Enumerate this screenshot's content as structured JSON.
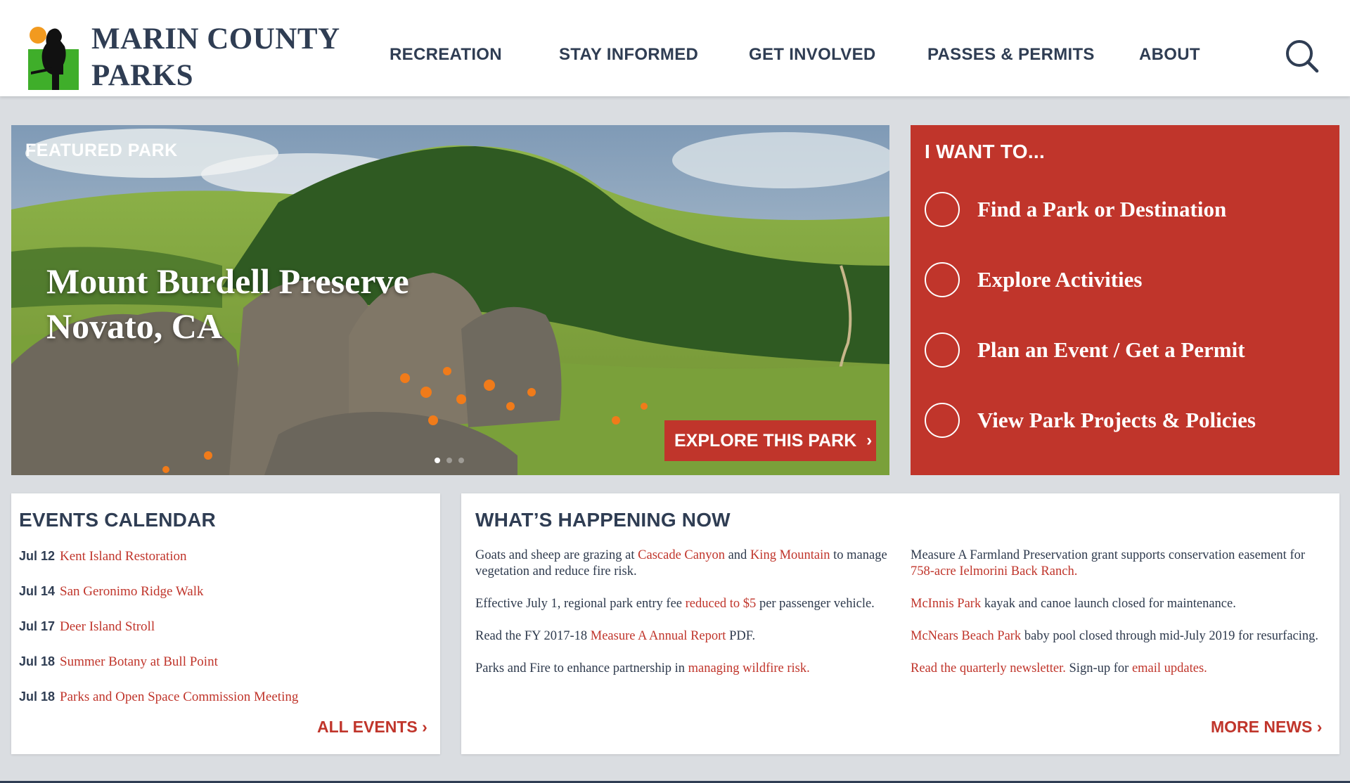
{
  "brand": {
    "line1": "MARIN COUNTY",
    "line2": "PARKS"
  },
  "nav": {
    "items": [
      "RECREATION",
      "STAY INFORMED",
      "GET INVOLVED",
      "PASSES & PERMITS",
      "ABOUT"
    ]
  },
  "featured": {
    "label": "FEATURED PARK",
    "title_line1": "Mount Burdell Preserve",
    "title_line2": "Novato, CA",
    "cta": "EXPLORE THIS PARK",
    "slide_count": 3,
    "active_slide": 1
  },
  "iwant": {
    "title": "I WANT TO...",
    "items": [
      "Find a Park or Destination",
      "Explore Activities",
      "Plan an Event / Get a Permit",
      "View Park Projects & Policies"
    ]
  },
  "events": {
    "title": "EVENTS CALENDAR",
    "items": [
      {
        "date": "Jul 12",
        "name": "Kent Island Restoration"
      },
      {
        "date": "Jul 14",
        "name": "San Geronimo Ridge Walk"
      },
      {
        "date": "Jul 17",
        "name": "Deer Island Stroll"
      },
      {
        "date": "Jul 18",
        "name": "Summer Botany at Bull Point"
      },
      {
        "date": "Jul 18",
        "name": "Parks and Open Space Commission Meeting"
      }
    ],
    "more": "ALL EVENTS"
  },
  "news": {
    "title": "WHAT’S HAPPENING NOW",
    "col1": [
      {
        "t1": "Goats and sheep are grazing at ",
        "l1": "Cascade Canyon",
        "t2": " and ",
        "l2": "King Mountain",
        "t3": " to manage vegetation and reduce fire risk."
      },
      {
        "t1": "Effective July 1, regional park entry fee ",
        "l1": "reduced to $5",
        "t2": " per passenger vehicle."
      },
      {
        "t1": "Read the FY 2017-18 ",
        "l1": "Measure A Annual Report",
        "t2": " PDF."
      },
      {
        "t1": "Parks and Fire to enhance partnership in ",
        "l1": "managing wildfire risk."
      }
    ],
    "col2": [
      {
        "t1": "Measure A Farmland Preservation grant supports conservation easement for ",
        "l1": "758-acre Ielmorini Back Ranch."
      },
      {
        "l1": "McInnis Park",
        "t2": " kayak and canoe launch closed for maintenance."
      },
      {
        "l1": "McNears Beach Park",
        "t2": " baby pool closed through mid-July 2019 for resurfacing."
      },
      {
        "l1": "Read the quarterly newsletter.",
        "t2": " Sign-up for ",
        "l2": "email updates."
      }
    ],
    "more": "MORE NEWS"
  },
  "colors": {
    "brand_red": "#c0352b",
    "navy": "#2f3d53",
    "page_bg": "#dadde1"
  }
}
